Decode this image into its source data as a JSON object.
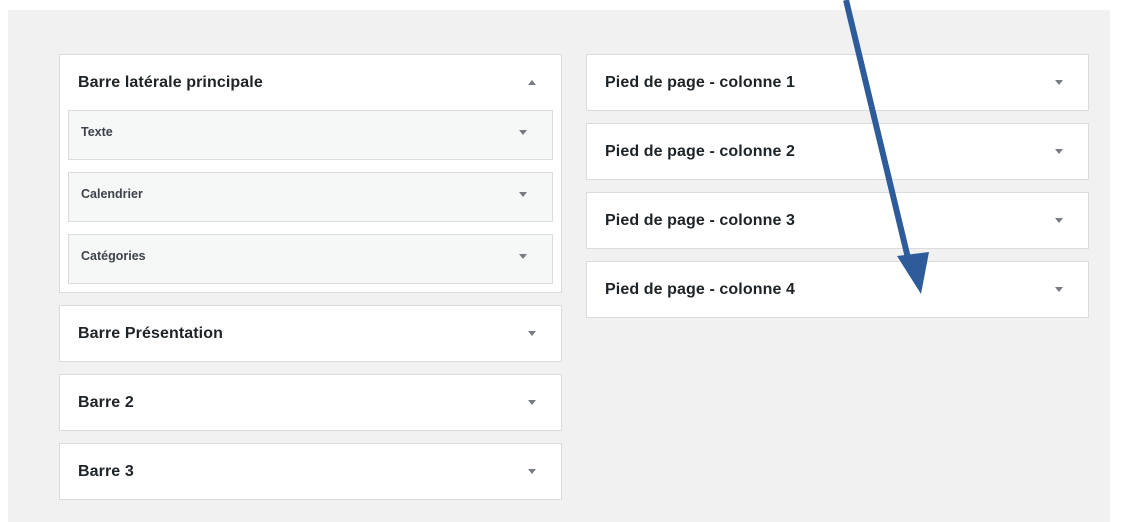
{
  "left_areas": {
    "main_sidebar": {
      "title": "Barre latérale principale",
      "widgets": [
        {
          "label": "Texte"
        },
        {
          "label": "Calendrier"
        },
        {
          "label": "Catégories"
        }
      ]
    },
    "others": [
      {
        "title": "Barre Présentation"
      },
      {
        "title": "Barre 2"
      },
      {
        "title": "Barre 3"
      }
    ]
  },
  "right_areas": [
    {
      "title": "Pied de page - colonne 1"
    },
    {
      "title": "Pied de page - colonne 2"
    },
    {
      "title": "Pied de page - colonne 3"
    },
    {
      "title": "Pied de page - colonne 4"
    }
  ],
  "icons": {
    "collapse": "triangle-up-icon",
    "expand": "triangle-down-icon"
  },
  "annotation": {
    "arrow_color": "#2e5c9a"
  }
}
